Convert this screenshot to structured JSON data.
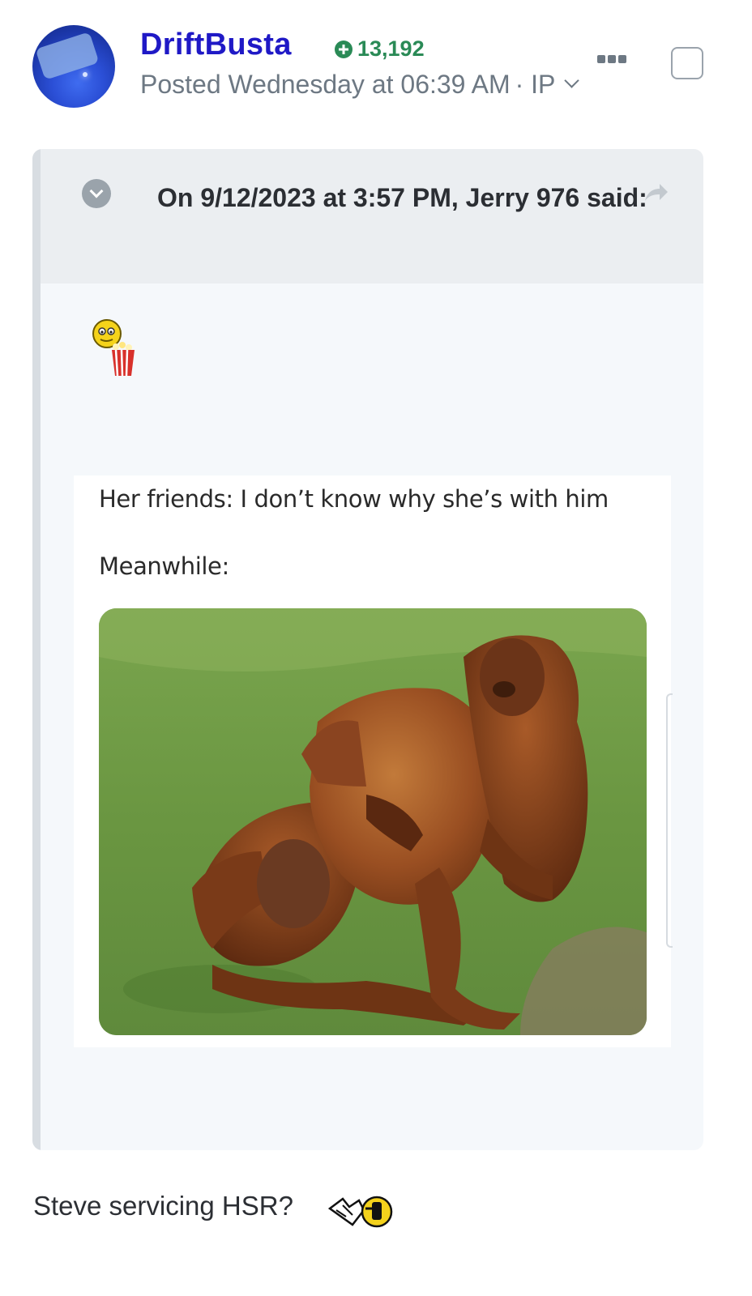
{
  "post": {
    "author": "DriftBusta",
    "reputation": "13,192",
    "meta_posted": "Posted Wednesday at 06:39 AM",
    "meta_ip": "· IP"
  },
  "quote": {
    "citation": "On 9/12/2023 at 3:57 PM, Jerry 976 said:",
    "meme_line_1": "Her friends: I don’t know why she’s with him",
    "meme_line_2": "Meanwhile:"
  },
  "reply": {
    "text": "Steve servicing HSR?"
  },
  "icons": {
    "reputation": "plus-circle-icon",
    "more": "ellipsis-icon",
    "quote_toggle": "chevron-down-circle-icon",
    "share": "share-arrow-icon",
    "popcorn_emoji": "popcorn-smiley-icon",
    "reply_emoji": "wrench-smiley-icon"
  },
  "colors": {
    "username": "#1f19c6",
    "reputation": "#2a8a56",
    "meta": "#6d7883",
    "quote_bg": "#f5f8fb",
    "quote_header_bg": "#ebeef1"
  }
}
